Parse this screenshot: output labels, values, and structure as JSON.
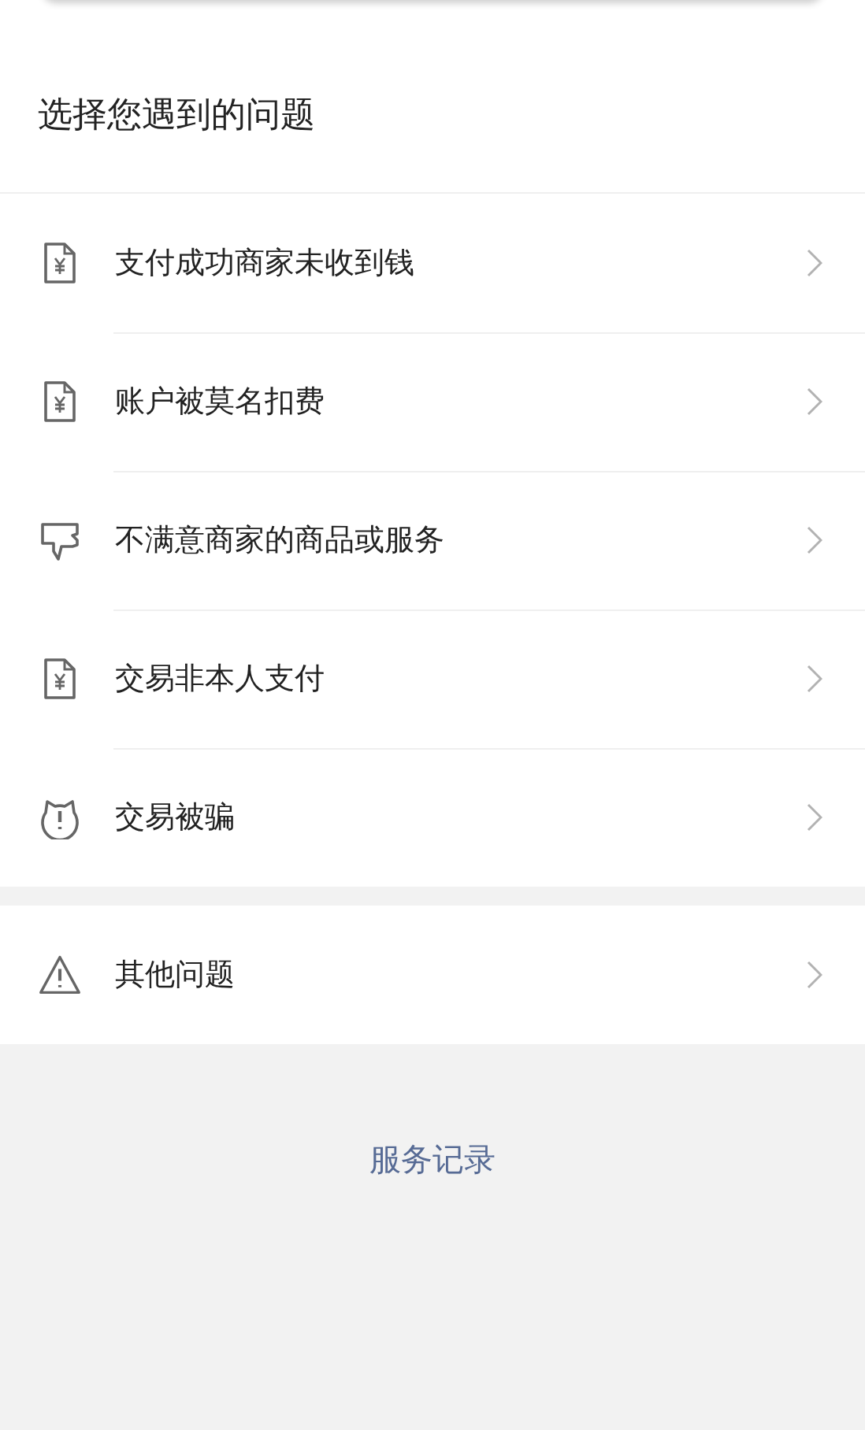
{
  "heading": "选择您遇到的问题",
  "problems": [
    {
      "kind": "bill",
      "label": "支付成功商家未收到钱"
    },
    {
      "kind": "bill",
      "label": "账户被莫名扣费"
    },
    {
      "kind": "thumb",
      "label": "不满意商家的商品或服务"
    },
    {
      "kind": "bill",
      "label": "交易非本人支付"
    },
    {
      "kind": "alarm",
      "label": "交易被骗"
    }
  ],
  "other": [
    {
      "kind": "warning",
      "label": "其他问题"
    }
  ],
  "footer_link": "服务记录"
}
